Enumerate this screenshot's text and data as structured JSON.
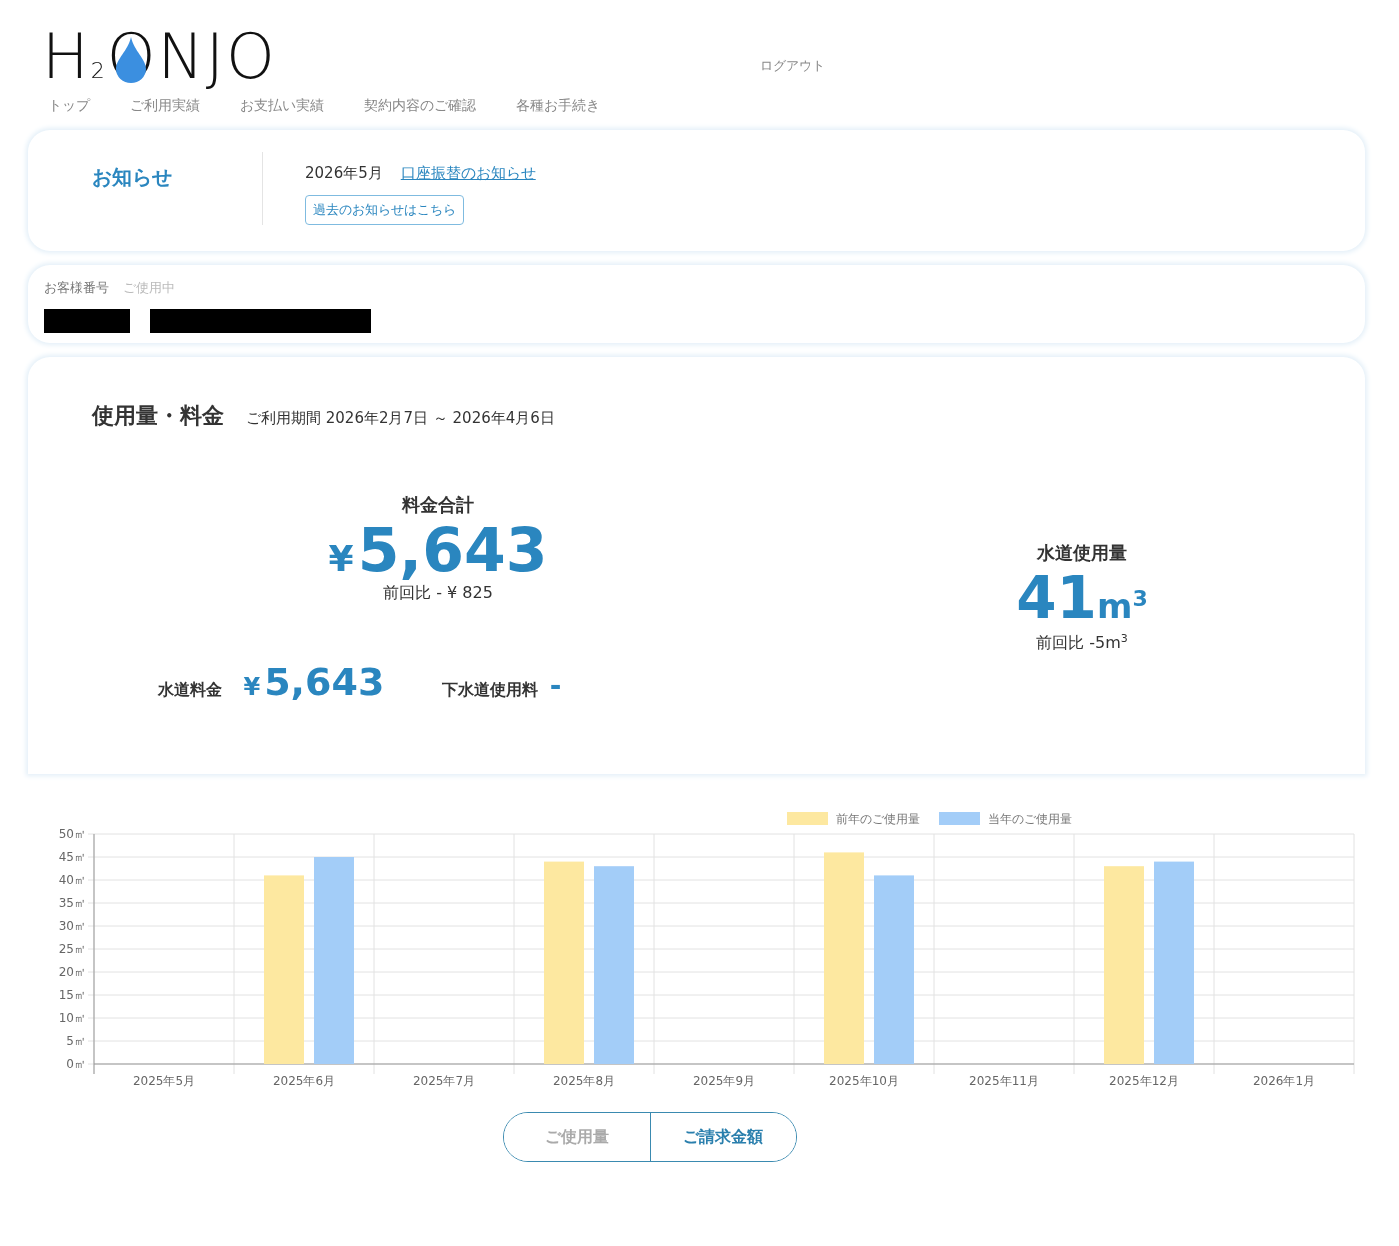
{
  "header": {
    "logo": "H$_{2}$ONJO",
    "nav": [
      "トップ",
      "ご利用実績",
      "お支払い実績",
      "契約内容のご確認",
      "各種お手続き"
    ],
    "logout": "ログアウト"
  },
  "notice": {
    "title": "お知らせ",
    "date": "2026年5月",
    "link": "口座振替のお知らせ",
    "past_button": "過去のお知らせはこちら"
  },
  "customer": {
    "number_label": "お客様番号",
    "status_label": "ご使用中"
  },
  "usage": {
    "title": "使用量・料金",
    "period": "ご利用期間 2026年2月7日 ～ 2026年4月6日",
    "total_label": "料金合計",
    "total_currency": "¥",
    "total": "5,643",
    "total_diff": "前回比 - ¥ 825",
    "volume_label": "水道使用量",
    "volume": "41",
    "volume_unit": "m$^{3}$",
    "volume_diff": "前回比 -5m$^{3}$",
    "water_fee_label": "水道料金",
    "water_fee_currency": "¥",
    "water_fee": "5,643",
    "sewer_label": "下水道使用料",
    "sewer_fee": "-"
  },
  "chart": {
    "chart_data": {
      "type": "bar",
      "grid": true,
      "legend": true,
      "categories": [
        "2025年5月",
        "2025年6月",
        "2025年7月",
        "2025年8月",
        "2025年9月",
        "2025年10月",
        "2025年11月",
        "2025年12月",
        "2026年1月"
      ],
      "series": [
        {
          "name": "前年のご使用量",
          "color": "#fde8a0",
          "values": [
            null,
            41,
            null,
            44,
            null,
            46,
            null,
            43,
            null
          ]
        },
        {
          "name": "当年のご使用量",
          "color": "#a3cdf8",
          "values": [
            null,
            45,
            null,
            43,
            null,
            41,
            null,
            44,
            null
          ]
        }
      ],
      "ylim": [
        0,
        50
      ],
      "yticks": [
        {
          "value": 0,
          "label": "0㎥"
        },
        {
          "value": 5,
          "label": "5㎥"
        },
        {
          "value": 10,
          "label": "10㎥"
        },
        {
          "value": 15,
          "label": "15㎥"
        },
        {
          "value": 20,
          "label": "20㎥"
        },
        {
          "value": 25,
          "label": "25㎥"
        },
        {
          "value": 30,
          "label": "30㎥"
        },
        {
          "value": 35,
          "label": "35㎥"
        },
        {
          "value": 40,
          "label": "40㎥"
        },
        {
          "value": 45,
          "label": "45㎥"
        },
        {
          "value": 50,
          "label": "50㎥"
        }
      ]
    }
  },
  "toggle": [
    {
      "label": "ご使用量",
      "selected": false
    },
    {
      "label": "ご請求金額",
      "selected": true
    }
  ]
}
